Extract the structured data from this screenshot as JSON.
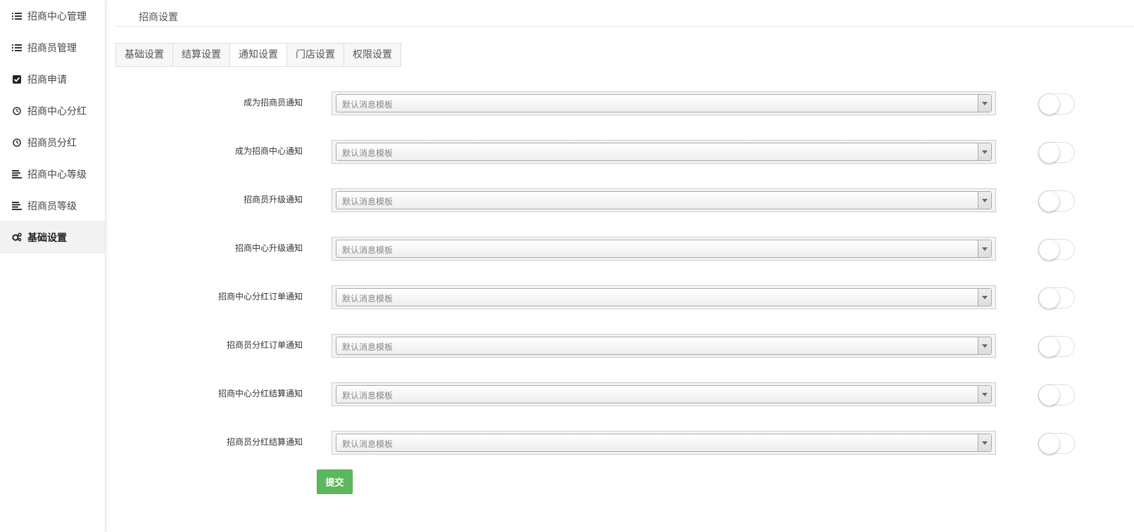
{
  "sidebar": {
    "items": [
      {
        "label": "招商中心管理",
        "icon": "list-icon"
      },
      {
        "label": "招商员管理",
        "icon": "list-icon"
      },
      {
        "label": "招商申请",
        "icon": "checkbox-icon"
      },
      {
        "label": "招商中心分红",
        "icon": "clock-icon"
      },
      {
        "label": "招商员分红",
        "icon": "clock-icon"
      },
      {
        "label": "招商中心等级",
        "icon": "align-left-icon"
      },
      {
        "label": "招商员等级",
        "icon": "align-left-icon"
      },
      {
        "label": "基础设置",
        "icon": "gears-icon",
        "active": true
      }
    ]
  },
  "page": {
    "title": "招商设置"
  },
  "tabs": [
    {
      "label": "基础设置"
    },
    {
      "label": "结算设置"
    },
    {
      "label": "通知设置",
      "active": true
    },
    {
      "label": "门店设置"
    },
    {
      "label": "权限设置"
    }
  ],
  "form": {
    "rows": [
      {
        "label": "成为招商员通知",
        "value": "默认消息模板",
        "enabled": false
      },
      {
        "label": "成为招商中心通知",
        "value": "默认消息模板",
        "enabled": false
      },
      {
        "label": "招商员升级通知",
        "value": "默认消息模板",
        "enabled": false
      },
      {
        "label": "招商中心升级通知",
        "value": "默认消息模板",
        "enabled": false
      },
      {
        "label": "招商中心分红订单通知",
        "value": "默认消息模板",
        "enabled": false
      },
      {
        "label": "招商员分红订单通知",
        "value": "默认消息模板",
        "enabled": false
      },
      {
        "label": "招商中心分红结算通知",
        "value": "默认消息模板",
        "enabled": false
      },
      {
        "label": "招商员分红结算通知",
        "value": "默认消息模板",
        "enabled": false
      }
    ],
    "submit_label": "提交"
  },
  "colors": {
    "submit": "#5cb85c",
    "active_sidebar_bg": "#f2f2f2"
  }
}
